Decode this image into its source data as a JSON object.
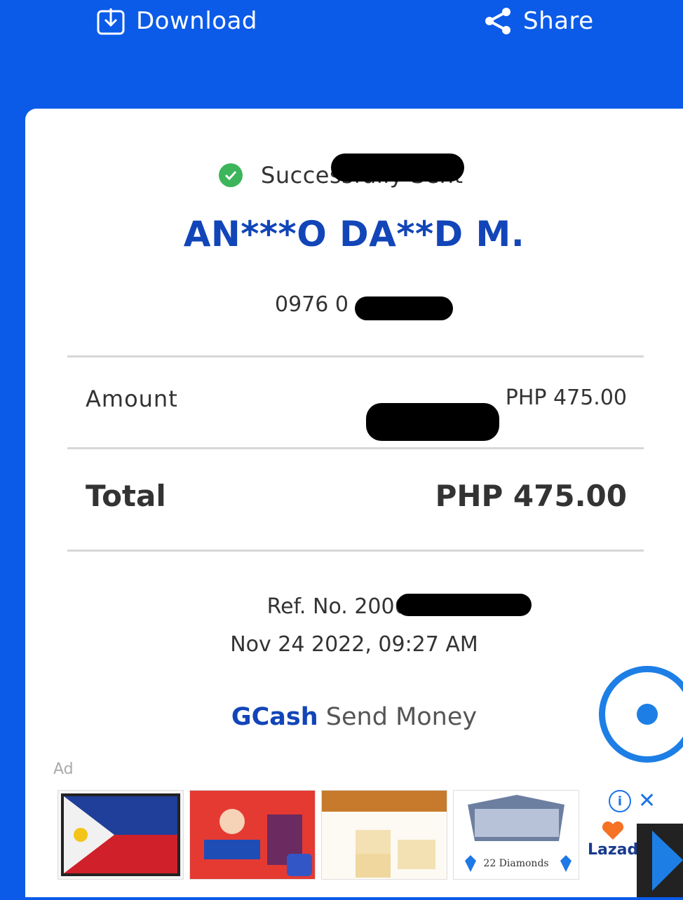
{
  "topbar": {
    "download_label": "Download",
    "share_label": "Share"
  },
  "receipt": {
    "status": "Successfully Sent",
    "recipient_name": "AN***O DA**D M.",
    "mobile_number": "0976 0",
    "amount_label": "Amount",
    "amount_value": "PHP 475.00",
    "total_label": "Total",
    "total_value": "PHP 475.00",
    "ref_no": "Ref. No. 2006 87",
    "datetime": "Nov 24 2022, 09:27 AM",
    "brand_name": "GCash",
    "brand_service": "Send Money"
  },
  "ad": {
    "label": "Ad",
    "tiles": [
      "philippine-flag-patch",
      "promo-poster",
      "food-product",
      "mobile-legends"
    ],
    "tile4_caption": "22 Diamonds",
    "advertiser": "Lazad"
  },
  "colors": {
    "primary": "#0b5be8",
    "brand_blue": "#1245b8",
    "success": "#3cb55b"
  }
}
